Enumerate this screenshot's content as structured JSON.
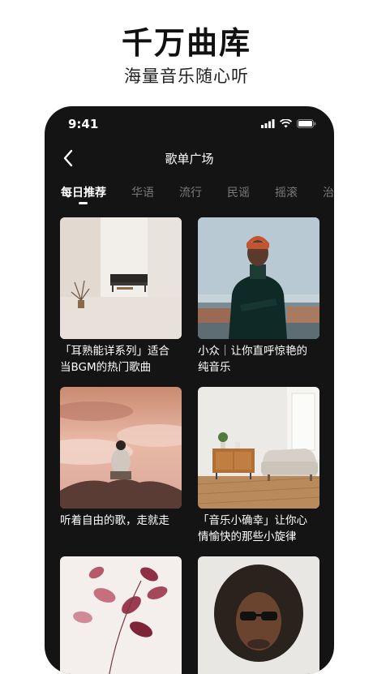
{
  "promo": {
    "title": "千万曲库",
    "subtitle": "海量音乐随心听"
  },
  "status_bar": {
    "time": "9:41",
    "icons": [
      "signal-icon",
      "wifi-icon",
      "battery-icon"
    ]
  },
  "nav": {
    "title": "歌单广场",
    "back_icon": "chevron-left-icon"
  },
  "tabs": [
    {
      "label": "每日推荐",
      "active": true
    },
    {
      "label": "华语",
      "active": false
    },
    {
      "label": "流行",
      "active": false
    },
    {
      "label": "民谣",
      "active": false
    },
    {
      "label": "摇滚",
      "active": false
    },
    {
      "label": "治",
      "active": false
    }
  ],
  "playlists": [
    {
      "caption": "「耳熟能详系列」适合\n当BGM的热门歌曲"
    },
    {
      "caption": "小众｜让你直呼惊艳的\n纯音乐"
    },
    {
      "caption": "听着自由的歌，走就走"
    },
    {
      "caption": "「音乐小确幸」让你心\n情愉快的那些小旋律"
    },
    {
      "caption": ""
    },
    {
      "caption": ""
    }
  ],
  "colors": {
    "background": "#141414",
    "text": "#ffffff",
    "inactive_tab": "#7a7a7a"
  }
}
